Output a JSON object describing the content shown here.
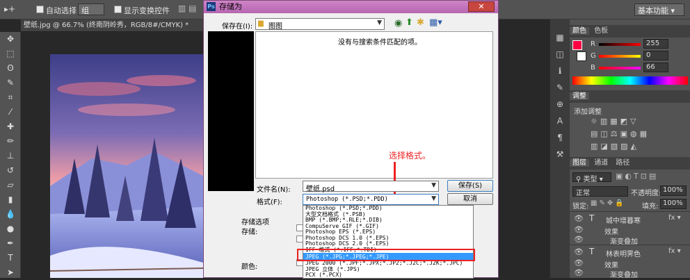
{
  "options_bar": {
    "auto_select_label": "自动选择：",
    "auto_select_value": "组",
    "show_transform_label": "显示变换控件",
    "workspace": "基本功能"
  },
  "doc_tab": {
    "title": "壁纸.jpg @ 66.7% (终南阴岭秀，RGB/8#/CMYK) *"
  },
  "dialog": {
    "title": "存储为",
    "save_in_label": "保存在(I):",
    "save_in_value": "图图",
    "empty_message": "没有与搜索条件匹配的项。",
    "filename_label": "文件名(N):",
    "filename_value": "壁纸.psd",
    "format_label": "格式(F):",
    "format_value": "Photoshop (*.PSD;*.PDD)",
    "save_button": "保存(S)",
    "cancel_button": "取消",
    "save_options_label": "存储选项",
    "store_label": "存储:",
    "color_label": "颜色:",
    "annotation": "选择格式。",
    "format_options": [
      "Photoshop (*.PSD;*.PDD)",
      "大型文档格式 (*.PSB)",
      "BMP (*.BMP;*.RLE;*.DIB)",
      "CompuServe GIF (*.GIF)",
      "Photoshop EPS (*.EPS)",
      "Photoshop DCS 1.0 (*.EPS)",
      "Photoshop DCS 2.0 (*.EPS)",
      "IFF 格式 (*.IFF;*.TDI)",
      "JPEG (*.JPG;*.JPEG;*.JPE)",
      "JPEG 2000 (*.JPF;*.JPX;*.JP2;*.J2C;*.J2K;*.JPC)",
      "JPEG 立体 (*.JPS)",
      "PCX (*.PCX)"
    ],
    "selected_format_index": 8
  },
  "color_panel": {
    "tabs": [
      "颜色",
      "色板"
    ],
    "r_label": "R",
    "r_value": "255",
    "g_label": "G",
    "g_value": "0",
    "b_label": "B",
    "b_value": "66",
    "accent": "#ff0042"
  },
  "adjust_panel": {
    "tab": "调整",
    "title": "添加调整"
  },
  "layers_panel": {
    "tabs": [
      "图层",
      "通道",
      "路径"
    ],
    "kind_label": "类型",
    "blend_mode": "正常",
    "opacity_label": "不透明度:",
    "opacity_value": "100%",
    "lock_label": "锁定:",
    "fill_label": "填充:",
    "fill_value": "100%",
    "layers": [
      {
        "name": "城中增暮寒",
        "effects_label": "效果",
        "effect": "渐变叠加"
      },
      {
        "name": "林表明霁色",
        "effects_label": "效果",
        "effect": "渐变叠加"
      }
    ]
  }
}
